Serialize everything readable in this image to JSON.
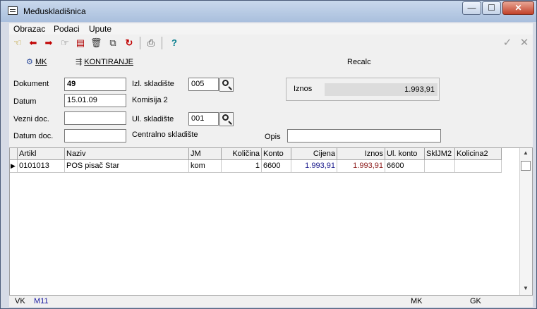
{
  "window": {
    "title": "Međuskladišnica",
    "controls": [
      "minimize",
      "maximize",
      "close"
    ],
    "control_glyphs": {
      "minimize": "—",
      "maximize": "☐",
      "close": "✕"
    }
  },
  "menu": [
    "Obrazac",
    "Podaci",
    "Upute"
  ],
  "toolbar": {
    "icons": [
      "open-icon",
      "arrow-left-icon",
      "arrow-right-icon",
      "pointer-icon",
      "new-document-icon",
      "trash-icon",
      "copy-icon",
      "refresh-icon",
      "print-icon",
      "help-icon",
      "confirm-icon",
      "cancel-icon"
    ],
    "glyphs": {
      "open": "☜",
      "prev": "⬅",
      "next": "➡",
      "pointer": "☞",
      "newdoc": "▤",
      "trash": "🗑",
      "copy": "⧉",
      "refresh": "↻",
      "print": "⎙",
      "help": "?",
      "confirm": "✓",
      "cancel": "✕"
    },
    "mk_label": "MK",
    "kontiranje_label": "KONTIRANJE",
    "recalc_label": "Recalc"
  },
  "form": {
    "dokument_label": "Dokument",
    "dokument_value": "49",
    "datum_label": "Datum",
    "datum_value": "15.01.09",
    "vezni_label": "Vezni doc.",
    "vezni_value": "",
    "datum_doc_label": "Datum doc.",
    "datum_doc_value": "",
    "izl_skladiste_label": "Izl. skladište",
    "izl_skladiste_value": "005",
    "izl_skladiste_name": "Komisija 2",
    "ul_skladiste_label": "Ul. skladište",
    "ul_skladiste_value": "001",
    "ul_skladiste_name": "Centralno skladište",
    "iznos_label": "Iznos",
    "iznos_value": "1.993,91",
    "opis_label": "Opis",
    "opis_value": ""
  },
  "grid": {
    "columns": [
      "Artikl",
      "Naziv",
      "JM",
      "Količina",
      "Konto",
      "Cijena",
      "Iznos",
      "Ul. konto",
      "SklJM2",
      "Kolicina2"
    ],
    "rows": [
      {
        "artikl": "0101013",
        "naziv": "POS pisač Star",
        "jm": "kom",
        "kolicina": "1",
        "konto": "6600",
        "cijena": "1.993,91",
        "iznos": "1.993,91",
        "ul_konto": "6600",
        "skljm2": "",
        "kolicina2": ""
      }
    ],
    "colors": {
      "cijena": "#1a1a8c",
      "iznos": "#8c1a1a"
    }
  },
  "status": {
    "left1": "VK",
    "left2": "M11",
    "right1": "MK",
    "right2": "GK",
    "left2_color": "#1a1aa0"
  }
}
